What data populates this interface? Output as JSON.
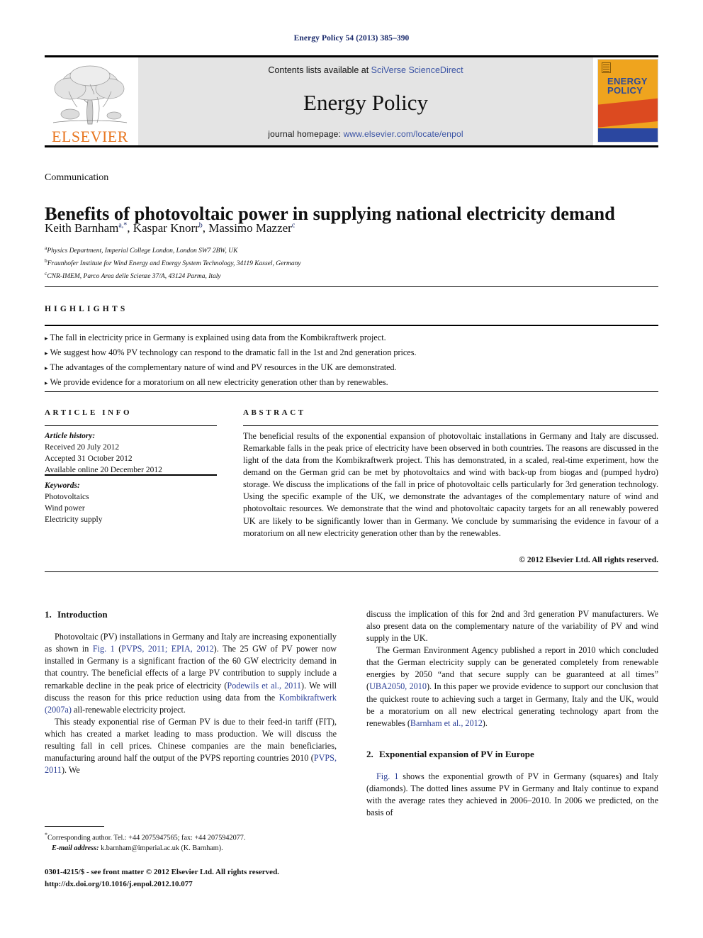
{
  "running_head": "Energy Policy 54 (2013) 385–390",
  "masthead": {
    "contents_prefix": "Contents lists available at ",
    "contents_link": "SciVerse ScienceDirect",
    "journal_title": "Energy Policy",
    "homepage_prefix": "journal homepage: ",
    "homepage_link": "www.elsevier.com/locate/enpol",
    "publisher_wordmark": "ELSEVIER",
    "cover_title_line1": "ENERGY",
    "cover_title_line2": "POLICY",
    "accent_orange": "#E87722",
    "accent_link_blue": "#3a53a4",
    "cover_gold": "#EFA41E",
    "cover_red": "#DC4A20",
    "cover_blue": "#2B47A0",
    "panel_grey": "#e4e4e4"
  },
  "article": {
    "section_type": "Communication",
    "title": "Benefits of photovoltaic power in supplying national electricity demand",
    "authors": [
      {
        "name": "Keith Barnham",
        "marks": "a,*"
      },
      {
        "name": "Kaspar Knorr",
        "marks": "b"
      },
      {
        "name": "Massimo Mazzer",
        "marks": "c"
      }
    ],
    "affiliations": [
      {
        "mark": "a",
        "text": "Physics Department, Imperial College London, London SW7 2BW, UK"
      },
      {
        "mark": "b",
        "text": "Fraunhofer Institute for Wind Energy and Energy System Technology, 34119 Kassel, Germany"
      },
      {
        "mark": "c",
        "text": "CNR-IMEM, Parco Area delle Scienze 37/A, 43124 Parma, Italy"
      }
    ]
  },
  "highlights": {
    "label": "HIGHLIGHTS",
    "bullet": "▸",
    "items": [
      "The fall in electricity price in Germany is explained using data from the Kombikraftwerk project.",
      "We suggest how 40% PV technology can respond to the dramatic fall in the 1st and 2nd generation prices.",
      "The advantages of the complementary nature of wind and PV resources in the UK are demonstrated.",
      "We provide evidence for a moratorium on all new electricity generation other than by renewables."
    ]
  },
  "article_info": {
    "label": "ARTICLE INFO",
    "history_label": "Article history:",
    "history": [
      "Received 20 July 2012",
      "Accepted 31 October 2012",
      "Available online 20 December 2012"
    ],
    "keywords_label": "Keywords:",
    "keywords": [
      "Photovoltaics",
      "Wind power",
      "Electricity supply"
    ]
  },
  "abstract": {
    "label": "ABSTRACT",
    "text": "The beneficial results of the exponential expansion of photovoltaic installations in Germany and Italy are discussed. Remarkable falls in the peak price of electricity have been observed in both countries. The reasons are discussed in the light of the data from the Kombikraftwerk project. This has demonstrated, in a scaled, real-time experiment, how the demand on the German grid can be met by photovoltaics and wind with back-up from biogas and (pumped hydro) storage. We discuss the implications of the fall in price of photovoltaic cells particularly for 3rd generation technology. Using the specific example of the UK, we demonstrate the advantages of the complementary nature of wind and photovoltaic resources. We demonstrate that the wind and photovoltaic capacity targets for an all renewably powered UK are likely to be significantly lower than in Germany. We conclude by summarising the evidence in favour of a moratorium on all new electricity generation other than by the renewables.",
    "copyright": "© 2012 Elsevier Ltd. All rights reserved."
  },
  "body": {
    "section1_number": "1.",
    "section1_title": "Introduction",
    "section2_number": "2.",
    "section2_title": "Exponential expansion of PV in Europe",
    "left_p1_a": "Photovoltaic (PV) installations in Germany and Italy are increasing exponentially as shown in ",
    "left_p1_ref1": "Fig. 1",
    "left_p1_b": " (",
    "left_p1_ref2": "PVPS, 2011; EPIA, 2012",
    "left_p1_c": "). The 25 GW of PV power now installed in Germany is a significant fraction of the 60 GW electricity demand in that country. The beneficial effects of a large PV contribution to supply include a remarkable decline in the peak price of electricity (",
    "left_p1_ref3": "Podewils et al., 2011",
    "left_p1_d": "). We will discuss the reason for this price reduction using data from the ",
    "left_p1_ref4": "Kombikraftwerk (2007a)",
    "left_p1_e": " all-renewable electricity project.",
    "left_p2_a": "This steady exponential rise of German PV is due to their feed-in tariff (FIT), which has created a market leading to mass production. We will discuss the resulting fall in cell prices. Chinese companies are the main beneficiaries, manufacturing around half the output of the PVPS reporting countries 2010 (",
    "left_p2_ref1": "PVPS, 2011",
    "left_p2_b": "). We",
    "right_p1": "discuss the implication of this for 2nd and 3rd generation PV manufacturers. We also present data on the complementary nature of the variability of PV and wind supply in the UK.",
    "right_p2_a": "The German Environment Agency published a report in 2010 which concluded that the German electricity supply can be generated completely from renewable energies by 2050 “and that secure supply can be guaranteed at all times” (",
    "right_p2_ref1": "UBA2050, 2010",
    "right_p2_b": "). In this paper we provide evidence to support our conclusion that the quickest route to achieving such a target in Germany, Italy and the UK, would be a moratorium on all new electrical generating technology apart from the renewables (",
    "right_p2_ref2": "Barnham et al., 2012",
    "right_p2_c": ").",
    "right_p3_a": "",
    "right_p3_ref1": "Fig. 1",
    "right_p3_b": " shows the exponential growth of PV in Germany (squares) and Italy (diamonds). The dotted lines assume PV in Germany and Italy continue to expand with the average rates they achieved in 2006–2010. In 2006 we predicted, on the basis of"
  },
  "footnote": {
    "star": "*",
    "corresponding": "Corresponding author. Tel.: +44 2075947565; fax: +44 2075942077.",
    "email_label": "E-mail address:",
    "email": " k.barnham@imperial.ac.uk (K. Barnham)."
  },
  "frontmatter": {
    "line1": "0301-4215/$ - see front matter © 2012 Elsevier Ltd. All rights reserved.",
    "line2": "http://dx.doi.org/10.1016/j.enpol.2012.10.077"
  }
}
